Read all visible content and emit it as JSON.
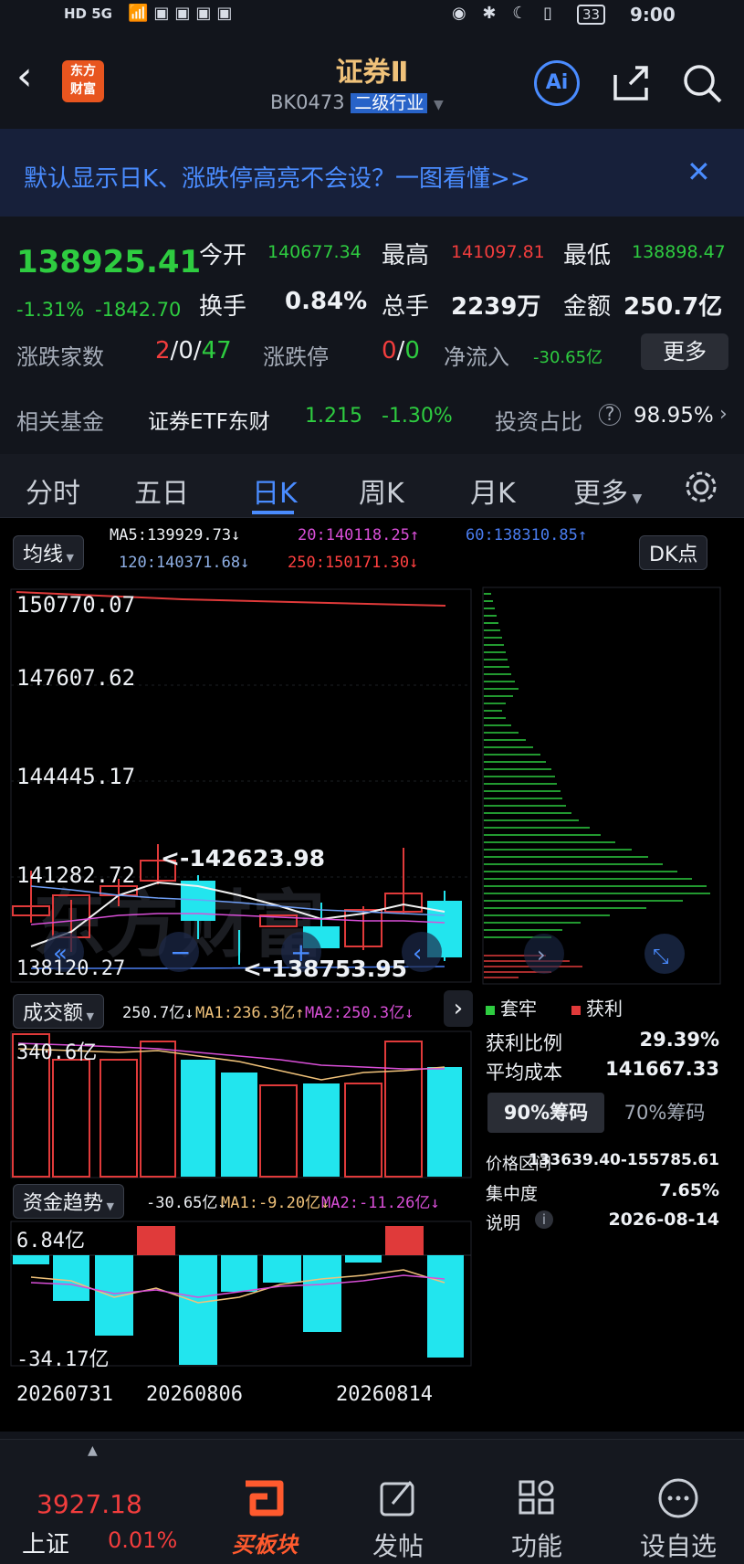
{
  "status_bar": {
    "network": "HD 5G",
    "battery": "33",
    "time": "9:00"
  },
  "header": {
    "logo_line1": "东方",
    "logo_line2": "财富",
    "title": "证券Ⅱ",
    "code": "BK0473",
    "tag": "二级行业",
    "ai_label": "Ai"
  },
  "banner": {
    "text": "默认显示日K、涨跌停高亮不会设？一图看懂>>"
  },
  "quote": {
    "price": "138925.41",
    "change_pct": "-1.31%",
    "change": "-1842.70",
    "open_label": "今开",
    "open": "140677.34",
    "high_label": "最高",
    "high": "141097.81",
    "low_label": "最低",
    "low": "138898.47",
    "turnover_label": "换手",
    "turnover": "0.84%",
    "volume_label": "总手",
    "volume": "2239万",
    "amount_label": "金额",
    "amount": "250.7亿",
    "adv_label": "涨跌家数",
    "adv_up": "2",
    "adv_flat": "0",
    "adv_down": "47",
    "limit_label": "涨跌停",
    "limit_up": "0",
    "limit_down": "0",
    "netflow_label": "净流入",
    "netflow": "-30.65亿",
    "more_label": "更多",
    "fund_label": "相关基金",
    "fund_name": "证券ETF东财",
    "fund_price": "1.215",
    "fund_pct": "-1.30%",
    "ratio_label": "投资占比",
    "ratio": "98.95%"
  },
  "tabs": [
    "分时",
    "五日",
    "日K",
    "周K",
    "月K",
    "更多"
  ],
  "active_tab": "日K",
  "kline": {
    "ma_selector": "均线",
    "ma5": "MA5:139929.73↓",
    "ma20": "20:140118.25↑",
    "ma60": "60:138310.85↑",
    "ma120": "120:140371.68↓",
    "ma250": "250:150171.30↓",
    "dk_button": "DK点",
    "y_labels": [
      "150770.07",
      "147607.62",
      "144445.17",
      "141282.72",
      "138120.27"
    ],
    "high_marker": "<-142623.98",
    "low_marker": "<-138753.95"
  },
  "volume": {
    "selector": "成交额",
    "value": "250.7亿↓",
    "ma1": "MA1:236.3亿↑",
    "ma2": "MA2:250.3亿↓",
    "ymax": "340.6亿"
  },
  "fund_flow": {
    "selector": "资金趋势",
    "value": "-30.65亿↓",
    "ma1": "MA1:-9.20亿↓",
    "ma2": "MA2:-11.26亿↓",
    "ymax": "6.84亿",
    "ymin": "-34.17亿"
  },
  "dates": [
    "20260731",
    "20260806",
    "20260814"
  ],
  "chips": {
    "legend_trap": "套牢",
    "legend_profit": "获利",
    "profit_ratio_label": "获利比例",
    "profit_ratio": "29.39%",
    "avg_cost_label": "平均成本",
    "avg_cost": "141667.33",
    "btn90": "90%筹码",
    "btn70": "70%筹码",
    "range_label": "价格区间",
    "range": "133639.40-155785.61",
    "concentration_label": "集中度",
    "concentration": "7.65%",
    "note_label": "说明",
    "note_date": "2026-08-14"
  },
  "bottom_nav": {
    "index_value": "3927.18",
    "index_name": "上证",
    "index_pct": "0.01%",
    "buy_block": "买板块",
    "post": "发帖",
    "functions": "功能",
    "watchlist": "设自选"
  },
  "colors": {
    "up": "#f23d3d",
    "down": "#2ecc40",
    "cyan": "#22e5ee",
    "accent": "#4a8cff",
    "gold": "#f0c27a"
  }
}
